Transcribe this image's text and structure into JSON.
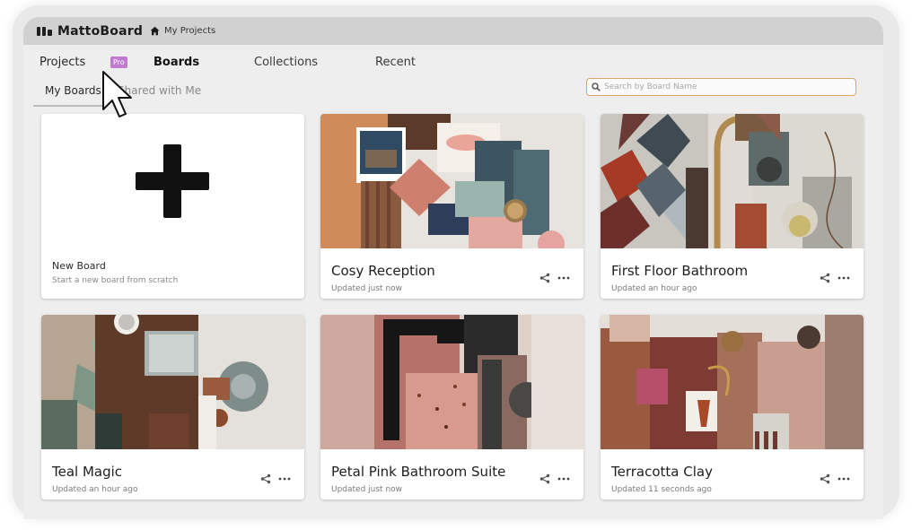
{
  "app": {
    "brand": "MattoBoard",
    "breadcrumb": "My Projects"
  },
  "nav": {
    "items": [
      "Projects",
      "Boards",
      "Collections",
      "Recent"
    ],
    "pro_badge": "Pro",
    "active": "Boards"
  },
  "subtabs": {
    "items": [
      "My Boards",
      "Shared with Me"
    ],
    "active": "My Boards"
  },
  "search": {
    "placeholder": "Search by Board Name",
    "value": ""
  },
  "new_board": {
    "title": "New Board",
    "subtitle": "Start a new board from scratch"
  },
  "boards": [
    {
      "title": "Cosy Reception",
      "updated": "Updated just now"
    },
    {
      "title": "First Floor Bathroom",
      "updated": "Updated an hour ago"
    },
    {
      "title": "Teal Magic",
      "updated": "Updated an hour ago"
    },
    {
      "title": "Petal Pink Bathroom Suite",
      "updated": "Updated just now"
    },
    {
      "title": "Terracotta Clay",
      "updated": "Updated 11 seconds ago"
    }
  ],
  "icons": {
    "logo": "mattoboard-logo-icon",
    "home": "home-icon",
    "search": "search-icon",
    "share": "share-icon",
    "more": "more-icon",
    "plus": "plus-icon",
    "cursor": "mouse-cursor-icon"
  },
  "colors": {
    "topbar": "#d1d1d1",
    "pro_badge": "#c07ad0",
    "search_border": "#d9a56c",
    "card": "#ffffff",
    "background": "#eeeeee"
  }
}
